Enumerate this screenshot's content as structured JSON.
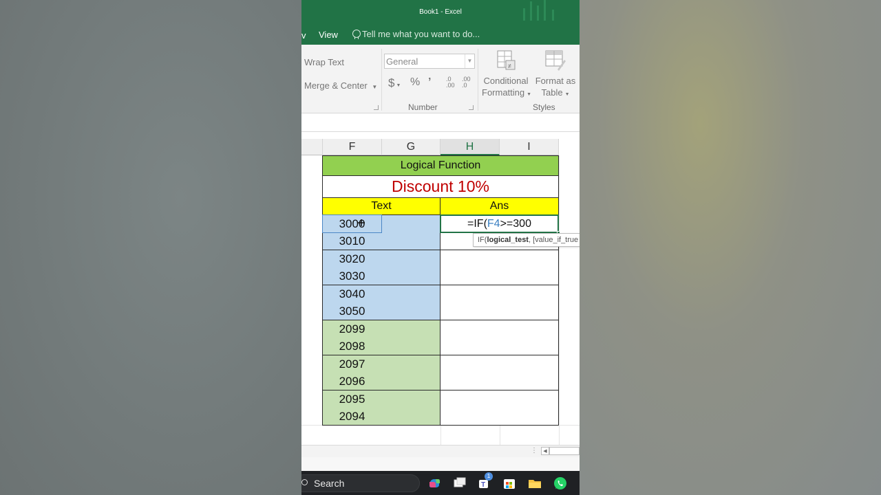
{
  "window": {
    "title": "Book1 - Excel"
  },
  "menu": {
    "partial_tab": "v",
    "view_tab": "View",
    "tell_me": "Tell me what you want to do..."
  },
  "ribbon": {
    "wrap_text": "Wrap Text",
    "merge_center": "Merge & Center",
    "number_format_value": "General",
    "currency": "$",
    "percent": "%",
    "comma": "’",
    "inc_decimal": ".0\n.00",
    "dec_decimal": ".00\n.0",
    "number_group": "Number",
    "conditional_formatting": [
      "Conditional",
      "Formatting"
    ],
    "format_as_table": [
      "Format as",
      "Table"
    ],
    "styles_group": "Styles"
  },
  "columns": [
    "F",
    "G",
    "H",
    "I"
  ],
  "selected_column": "H",
  "sheet": {
    "title": "Logical Function",
    "subtitle": "Discount 10%",
    "col_text_header": "Text",
    "col_ans_header": "Ans",
    "formula_input": {
      "prefix": "=IF(",
      "ref": "F4",
      "suffix": ">=300"
    },
    "tooltip": {
      "fn": "IF(",
      "arg1": "logical_test",
      "rest": ", [value_if_true"
    },
    "rows_blue": [
      "3000",
      "3010",
      "3020",
      "3030",
      "3040",
      "3050"
    ],
    "rows_green": [
      "2099",
      "2098",
      "2097",
      "2096",
      "2095",
      "2094"
    ]
  },
  "taskbar": {
    "search": "Search",
    "teams_badge": "1"
  },
  "colors": {
    "excel_green": "#217346",
    "title_fill": "#92d050",
    "discount_text": "#c00000",
    "header_fill": "#ffff00",
    "blue_fill": "#bdd7ee",
    "green_fill": "#c6e0b4"
  }
}
